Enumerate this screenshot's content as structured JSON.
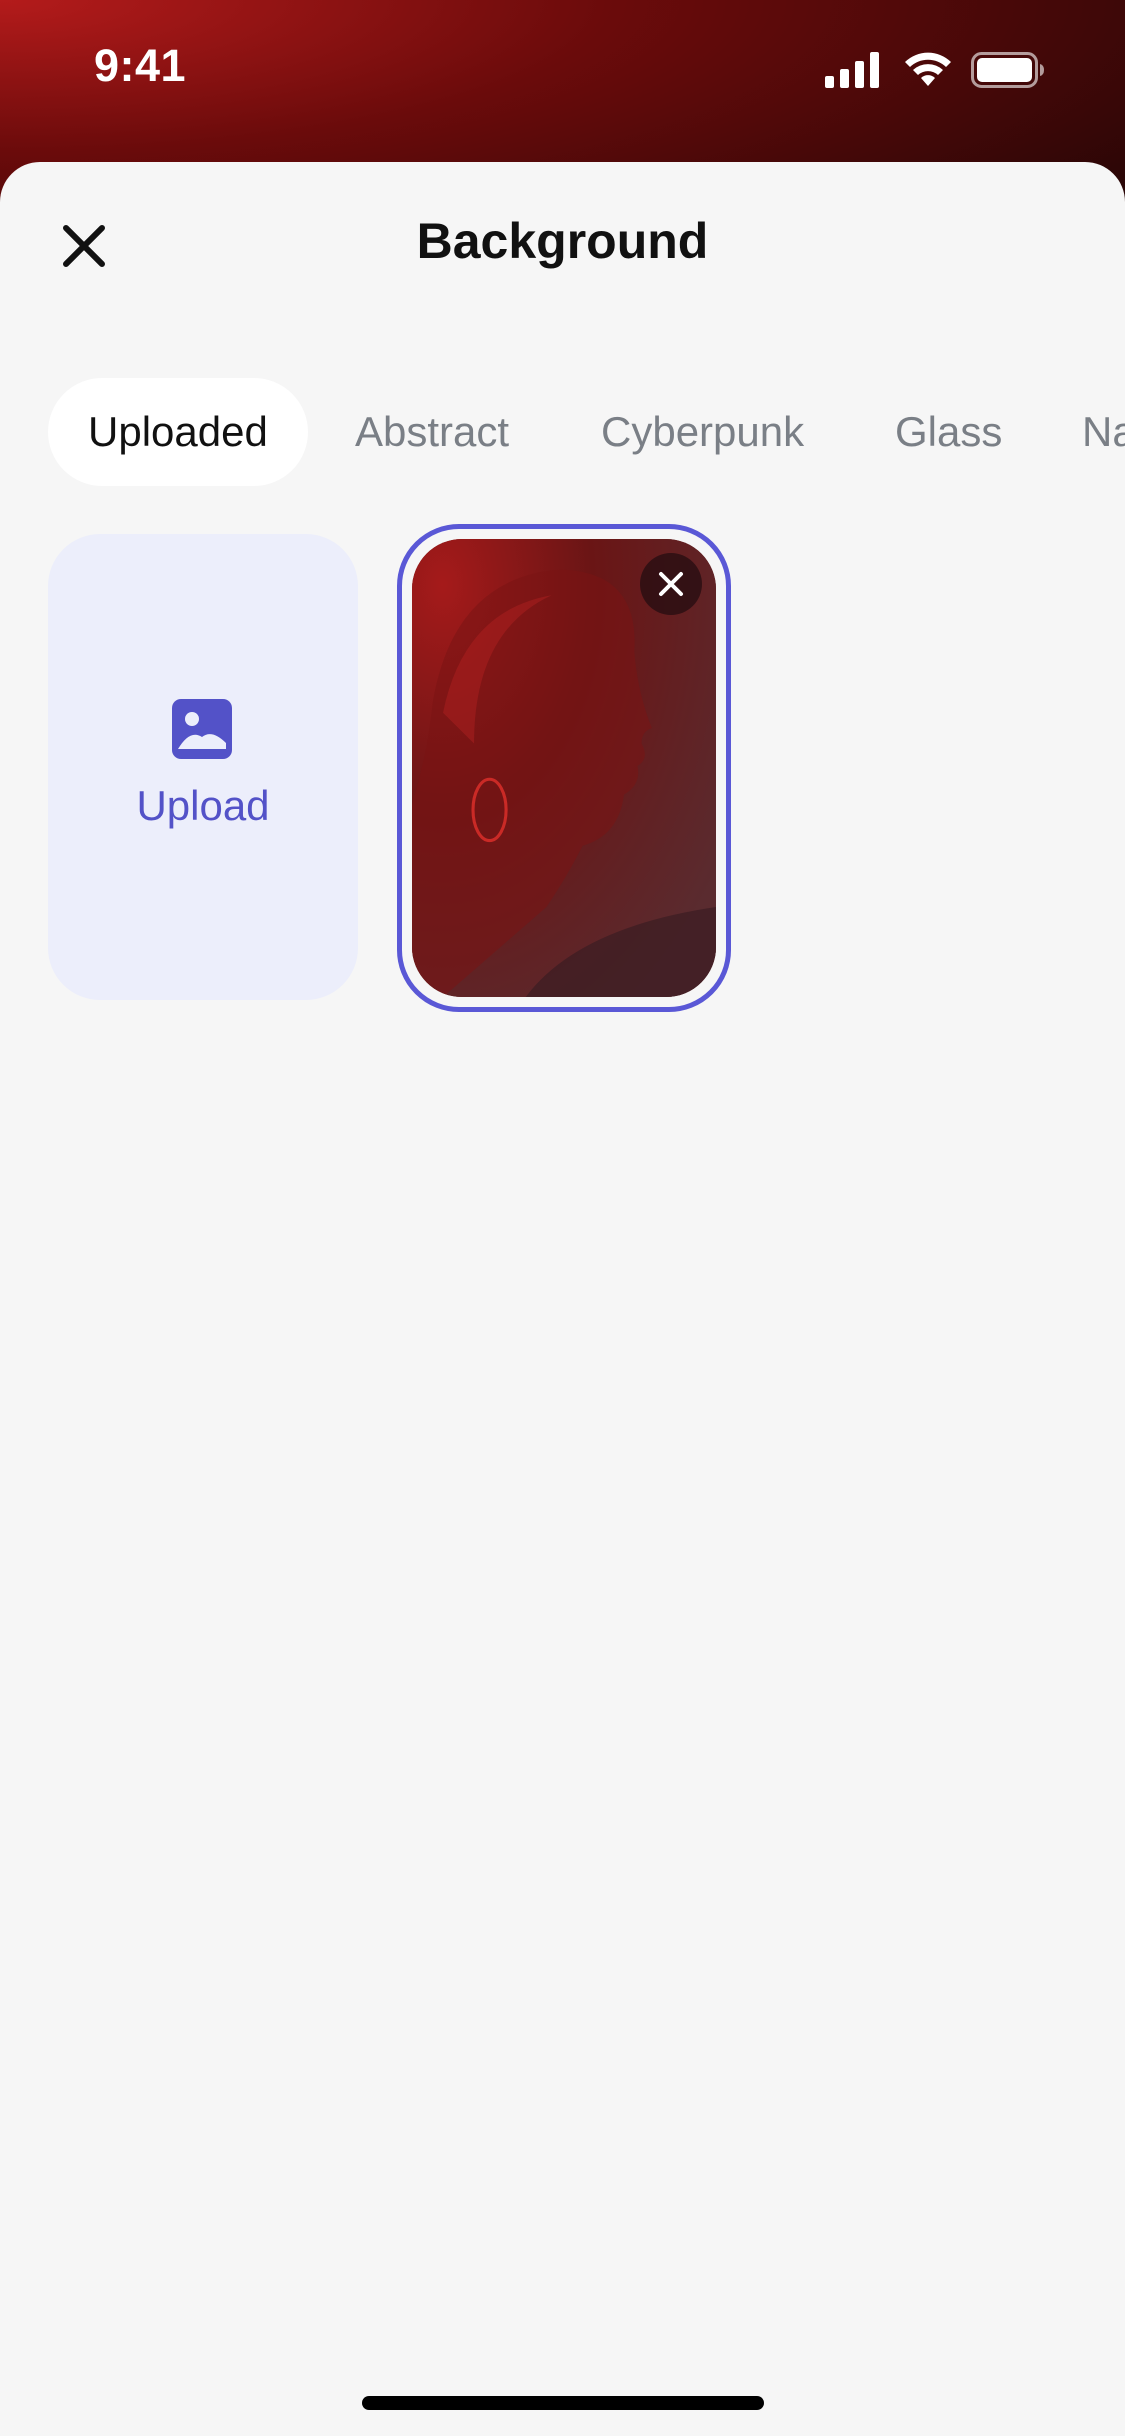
{
  "status_bar": {
    "time": "9:41",
    "icons": [
      "signal-icon",
      "wifi-icon",
      "battery-icon"
    ]
  },
  "sheet": {
    "title": "Background",
    "close_icon": "close-icon"
  },
  "tabs": [
    {
      "label": "Uploaded",
      "active": true
    },
    {
      "label": "Abstract",
      "active": false
    },
    {
      "label": "Cyberpunk",
      "active": false
    },
    {
      "label": "Glass",
      "active": false
    },
    {
      "label": "Na",
      "active": false
    }
  ],
  "upload": {
    "label": "Upload",
    "icon": "image-icon"
  },
  "uploaded_images": [
    {
      "selected": true,
      "remove_icon": "close-icon"
    }
  ],
  "colors": {
    "accent": "#5a58d6",
    "upload_bg": "#eceefb",
    "sheet_bg": "#f6f6f6",
    "active_tab_bg": "#ffffff",
    "inactive_tab_text": "#7a7f86"
  }
}
